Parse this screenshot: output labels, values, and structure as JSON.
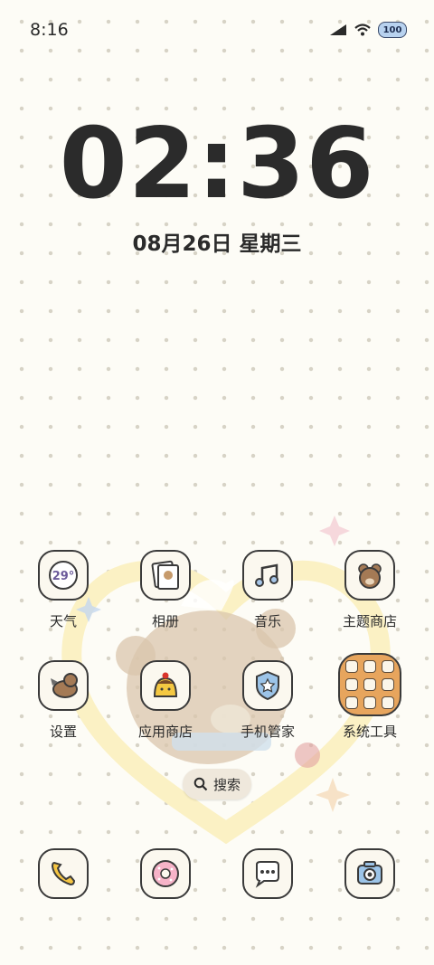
{
  "status_bar": {
    "time": "8:16",
    "battery_level": "100"
  },
  "lock_clock": {
    "time": "02:36",
    "date": "08月26日 星期三"
  },
  "apps_row1": [
    {
      "label": "天气",
      "icon": "weather-icon",
      "temp": "29°"
    },
    {
      "label": "相册",
      "icon": "gallery-icon"
    },
    {
      "label": "音乐",
      "icon": "music-icon"
    },
    {
      "label": "主题商店",
      "icon": "theme-store-icon"
    }
  ],
  "apps_row2": [
    {
      "label": "设置",
      "icon": "settings-icon"
    },
    {
      "label": "应用商店",
      "icon": "app-store-icon"
    },
    {
      "label": "手机管家",
      "icon": "phone-manager-icon"
    },
    {
      "label": "系统工具",
      "icon": "folder-icon"
    }
  ],
  "search": {
    "label": "搜索"
  },
  "dock": [
    "phone-icon",
    "browser-icon",
    "messages-icon",
    "camera-icon"
  ],
  "colors": {
    "accent": "#e7a55d",
    "text": "#2b2b2b",
    "background": "#fdfcf6"
  }
}
